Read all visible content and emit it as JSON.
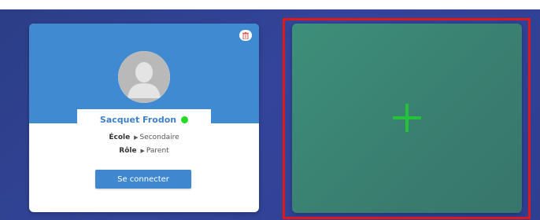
{
  "profile": {
    "name": "Sacquet Frodon",
    "online": true,
    "school_label": "École",
    "school_value": "Secondaire",
    "role_label": "Rôle",
    "role_value": "Parent",
    "connect_label": "Se connecter",
    "avatar_icon": "user-silhouette-icon",
    "remove_icon": "trash-icon"
  },
  "add_card": {
    "icon": "plus-icon",
    "highlighted": true
  },
  "colors": {
    "background": "#33449a",
    "card_header": "#3f8ad0",
    "connect_button": "#3f88cf",
    "status_online": "#22dd22",
    "add_card": "#3a7e70",
    "plus": "#23c23a",
    "highlight_border": "#e01818"
  }
}
